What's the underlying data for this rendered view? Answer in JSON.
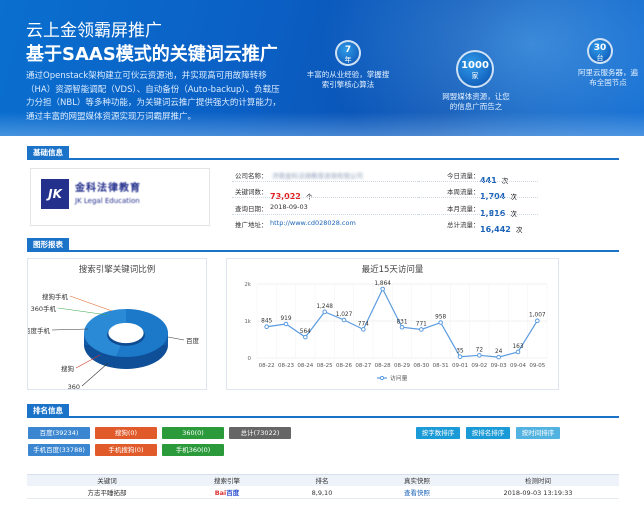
{
  "banner": {
    "title1": "云上金领霸屏推广",
    "title2": "基于SAAS模式的关键词云推广",
    "description": "通过Openstack架构建立可伙云资源池，并实现高可用故障转移（HA）资源智能调配（VDS）、自动备份（Auto-backup）、负载压力分担（NBL）等多种功能，为关键词云推广提供强大的计算能力，通过丰富的网盟媒体资源实现万词霸屏推广。",
    "circles": [
      {
        "number": "7",
        "unit": "年",
        "note": "丰富的从业经验，掌握搜索引擎核心算法"
      },
      {
        "number": "1000",
        "unit": "家",
        "note": "网盟媒体资源，让您的信息广而告之"
      },
      {
        "number": "30",
        "unit": "台",
        "note": "阿里云服务器，遍布全国节点"
      }
    ],
    "colors": {
      "primary": "#0b5fc4",
      "accent": "#1a73c9"
    }
  },
  "basic": {
    "header": "基础信息",
    "logo": {
      "cn": "金科法律教育",
      "en": "JK Legal Education"
    },
    "company_label": "公司名称：",
    "company_value": "济南金科法律教育咨询有限公司",
    "keywords_label": "关键词数：",
    "keywords_value": "73,022",
    "keywords_unit": "个",
    "date_label": "查询日期：",
    "date_value": "2018-09-03",
    "url_label": "推广地址：",
    "url_value": "http://www.cd028028.com",
    "stats": [
      {
        "label": "今日流量：",
        "value": "441",
        "unit": "次"
      },
      {
        "label": "本周流量：",
        "value": "1,704",
        "unit": "次"
      },
      {
        "label": "本月流量：",
        "value": "1,816",
        "unit": "次"
      },
      {
        "label": "总计流量：",
        "value": "16,442",
        "unit": "次"
      }
    ]
  },
  "charts_header": "图形报表",
  "chart_data": [
    {
      "type": "pie",
      "title": "搜索引擎关键词比例",
      "slices": [
        {
          "name": "百度",
          "value": 39234,
          "color": "#1c78c9"
        },
        {
          "name": "搜狗",
          "value": 0,
          "color": "#d63a2a"
        },
        {
          "name": "360",
          "value": 0,
          "color": "#1f9e3a"
        },
        {
          "name": "百度手机",
          "value": 33788,
          "color": "#2a8ad6"
        },
        {
          "name": "搜狗手机",
          "value": 0,
          "color": "#e0672a"
        },
        {
          "name": "360手机",
          "value": 0,
          "color": "#3aa84f"
        }
      ]
    },
    {
      "type": "line",
      "title": "最近15天访问量",
      "categories": [
        "08-22",
        "08-23",
        "08-24",
        "08-25",
        "08-26",
        "08-27",
        "08-28",
        "08-29",
        "08-30",
        "08-31",
        "09-01",
        "09-02",
        "09-03",
        "09-04",
        "09-05"
      ],
      "series": [
        {
          "name": "访问量",
          "values": [
            845,
            919,
            564,
            1248,
            1027,
            774,
            1864,
            831,
            771,
            958,
            35,
            72,
            24,
            163,
            1007
          ],
          "color": "#5b9be0"
        }
      ],
      "value_labels": [
        "845",
        "919",
        "564",
        "1,248",
        "1,027",
        "774",
        "1,864",
        "831",
        "771",
        "958",
        "35",
        "72",
        "24",
        "163",
        "1,007"
      ],
      "y_ticks": [
        "0",
        "1k",
        "2k"
      ],
      "ylim": [
        0,
        2000
      ],
      "legend": "bottom"
    }
  ],
  "ranking": {
    "header": "排名信息",
    "buttons_row1": [
      {
        "label": "百度(39234)",
        "color": "#3a86d0"
      },
      {
        "label": "搜狗(0)",
        "color": "#e05a2a"
      },
      {
        "label": "360(0)",
        "color": "#2a9a3a"
      },
      {
        "label": "总计(73022)",
        "color": "#666666"
      }
    ],
    "buttons_row2": [
      {
        "label": "手机百度(33788)",
        "color": "#3a86d0"
      },
      {
        "label": "手机搜狗(0)",
        "color": "#e05a2a"
      },
      {
        "label": "手机360(0)",
        "color": "#2a9a3a"
      }
    ],
    "sort_buttons": [
      "按字数排序",
      "按排名排序",
      "按时间排序"
    ],
    "columns": [
      "关键词",
      "搜索引擎",
      "排名",
      "真实快照",
      "检测时间"
    ],
    "rows": [
      {
        "keyword": "方志平睡拓部",
        "engine": "百度",
        "rank": "8,9,10",
        "snapshot": "查看快照",
        "time": "2018-09-03 13:19:33"
      }
    ]
  }
}
